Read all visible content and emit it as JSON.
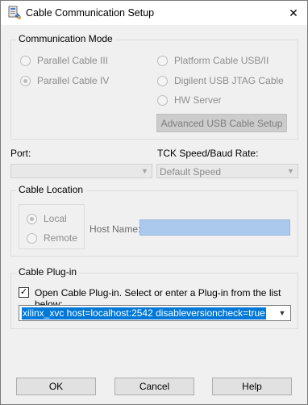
{
  "window": {
    "title": "Cable Communication Setup",
    "close_glyph": "✕"
  },
  "communication_mode": {
    "legend": "Communication Mode",
    "options": [
      {
        "label": "Parallel Cable III",
        "checked": false
      },
      {
        "label": "Parallel Cable IV",
        "checked": true
      },
      {
        "label": "Platform Cable USB/II",
        "checked": false
      },
      {
        "label": "Digilent USB JTAG Cable",
        "checked": false
      },
      {
        "label": "HW Server",
        "checked": false
      }
    ],
    "advanced_button": "Advanced USB Cable Setup"
  },
  "port": {
    "label": "Port:",
    "value": ""
  },
  "tck_speed": {
    "label": "TCK Speed/Baud Rate:",
    "value": "Default Speed"
  },
  "cable_location": {
    "legend": "Cable Location",
    "options": [
      {
        "label": "Local",
        "checked": true
      },
      {
        "label": "Remote",
        "checked": false
      }
    ],
    "host_name_label": "Host Name:",
    "host_name_value": ""
  },
  "cable_plugin": {
    "legend": "Cable Plug-in",
    "checkbox_label": "Open Cable Plug-in. Select or enter a Plug-in from the list below:",
    "checkbox_checked": true,
    "plugin_value": "xilinx_xvc host=localhost:2542 disableversioncheck=true"
  },
  "buttons": {
    "ok": "OK",
    "cancel": "Cancel",
    "help": "Help"
  },
  "colors": {
    "selection": "#0078d7",
    "host_field": "#aac9ec",
    "disabled_text": "#8d8d8d"
  }
}
